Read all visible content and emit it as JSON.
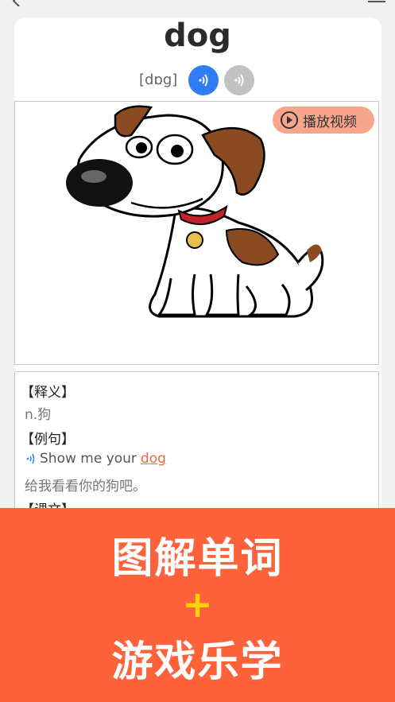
{
  "word": "dog",
  "phonetic": "[dɒg]",
  "video_button": {
    "label": "播放视频"
  },
  "definition": {
    "heading": "【释义】",
    "text": "n.狗"
  },
  "example": {
    "heading": "【例句】",
    "sentence_prefix": "Show me your",
    "sentence_keyword": "dog",
    "translation": "给我看看你的狗吧。"
  },
  "text_section": {
    "heading": "【课文】"
  },
  "banner": {
    "line1": "图解单词",
    "plus": "+",
    "line2": "游戏乐学"
  },
  "colors": {
    "accent": "#fd623a",
    "audio_us": "#2f7cf5",
    "audio_uk": "#c2c2c2",
    "highlight": "#f06a3a",
    "plus": "#ffd400"
  },
  "icons": {
    "back": "back-chevron-icon",
    "menu": "menu-icon",
    "audio": "speaker-wave-icon",
    "play": "play-circle-icon"
  }
}
